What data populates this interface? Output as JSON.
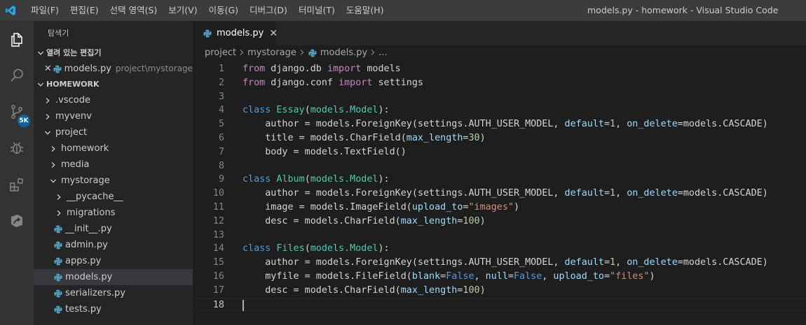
{
  "app": {
    "window_title": "models.py - homework - Visual Studio Code",
    "menu": [
      "파일(F)",
      "편집(E)",
      "선택 영역(S)",
      "보기(V)",
      "이동(G)",
      "디버그(D)",
      "터미널(T)",
      "도움말(H)"
    ]
  },
  "activity": {
    "scm_badge": "5K"
  },
  "sidebar": {
    "title": "탐색기",
    "open_editors_header": "열려 있는 편집기",
    "open_editor": {
      "name": "models.py",
      "path": "project\\mystorage"
    },
    "workspace_header": "HOMEWORK",
    "tree": [
      {
        "label": ".vscode",
        "kind": "folder",
        "open": false,
        "depth": 1
      },
      {
        "label": "myvenv",
        "kind": "folder",
        "open": false,
        "depth": 1
      },
      {
        "label": "project",
        "kind": "folder",
        "open": true,
        "depth": 1
      },
      {
        "label": "homework",
        "kind": "folder",
        "open": false,
        "depth": 2
      },
      {
        "label": "media",
        "kind": "folder",
        "open": false,
        "depth": 2
      },
      {
        "label": "mystorage",
        "kind": "folder",
        "open": true,
        "depth": 2
      },
      {
        "label": "__pycache__",
        "kind": "folder",
        "open": false,
        "depth": 3
      },
      {
        "label": "migrations",
        "kind": "folder",
        "open": false,
        "depth": 3
      },
      {
        "label": "__init__.py",
        "kind": "py",
        "depth": 3
      },
      {
        "label": "admin.py",
        "kind": "py",
        "depth": 3
      },
      {
        "label": "apps.py",
        "kind": "py",
        "depth": 3
      },
      {
        "label": "models.py",
        "kind": "py",
        "depth": 3,
        "selected": true
      },
      {
        "label": "serializers.py",
        "kind": "py",
        "depth": 3
      },
      {
        "label": "tests.py",
        "kind": "py",
        "depth": 3
      }
    ]
  },
  "editor": {
    "tab": {
      "label": "models.py"
    },
    "breadcrumb": [
      "project",
      "mystorage",
      "models.py",
      "..."
    ],
    "current_line": 18,
    "lines": [
      [
        [
          "kw",
          "from"
        ],
        [
          "t",
          " django.db "
        ],
        [
          "kw",
          "import"
        ],
        [
          "t",
          " models"
        ]
      ],
      [
        [
          "kw",
          "from"
        ],
        [
          "t",
          " django.conf "
        ],
        [
          "kw",
          "import"
        ],
        [
          "t",
          " settings"
        ]
      ],
      [],
      [
        [
          "kb",
          "class"
        ],
        [
          "t",
          " "
        ],
        [
          "cls",
          "Essay"
        ],
        [
          "t",
          "("
        ],
        [
          "cls",
          "models.Model"
        ],
        [
          "t",
          "):"
        ]
      ],
      [
        [
          "t",
          "    author = models.ForeignKey(settings.AUTH_USER_MODEL, "
        ],
        [
          "prm",
          "default"
        ],
        [
          "t",
          "="
        ],
        [
          "num",
          "1"
        ],
        [
          "t",
          ", "
        ],
        [
          "prm",
          "on_delete"
        ],
        [
          "t",
          "=models.CASCADE)"
        ]
      ],
      [
        [
          "t",
          "    title = models.CharField("
        ],
        [
          "prm",
          "max_length"
        ],
        [
          "t",
          "="
        ],
        [
          "num",
          "30"
        ],
        [
          "t",
          ")"
        ]
      ],
      [
        [
          "t",
          "    body = models.TextField()"
        ]
      ],
      [],
      [
        [
          "kb",
          "class"
        ],
        [
          "t",
          " "
        ],
        [
          "cls",
          "Album"
        ],
        [
          "t",
          "("
        ],
        [
          "cls",
          "models.Model"
        ],
        [
          "t",
          "):"
        ]
      ],
      [
        [
          "t",
          "    author = models.ForeignKey(settings.AUTH_USER_MODEL, "
        ],
        [
          "prm",
          "default"
        ],
        [
          "t",
          "="
        ],
        [
          "num",
          "1"
        ],
        [
          "t",
          ", "
        ],
        [
          "prm",
          "on_delete"
        ],
        [
          "t",
          "=models.CASCADE)"
        ]
      ],
      [
        [
          "t",
          "    image = models.ImageField("
        ],
        [
          "prm",
          "upload_to"
        ],
        [
          "t",
          "="
        ],
        [
          "str",
          "\"images\""
        ],
        [
          "t",
          ")"
        ]
      ],
      [
        [
          "t",
          "    desc = models.CharField("
        ],
        [
          "prm",
          "max_length"
        ],
        [
          "t",
          "="
        ],
        [
          "num",
          "100"
        ],
        [
          "t",
          ")"
        ]
      ],
      [],
      [
        [
          "kb",
          "class"
        ],
        [
          "t",
          " "
        ],
        [
          "cls",
          "Files"
        ],
        [
          "t",
          "("
        ],
        [
          "cls",
          "models.Model"
        ],
        [
          "t",
          "):"
        ]
      ],
      [
        [
          "t",
          "    author = models.ForeignKey(settings.AUTH_USER_MODEL, "
        ],
        [
          "prm",
          "default"
        ],
        [
          "t",
          "="
        ],
        [
          "num",
          "1"
        ],
        [
          "t",
          ", "
        ],
        [
          "prm",
          "on_delete"
        ],
        [
          "t",
          "=models.CASCADE)"
        ]
      ],
      [
        [
          "t",
          "    myfile = models.FileField("
        ],
        [
          "prm",
          "blank"
        ],
        [
          "t",
          "="
        ],
        [
          "kb",
          "False"
        ],
        [
          "t",
          ", "
        ],
        [
          "prm",
          "null"
        ],
        [
          "t",
          "="
        ],
        [
          "kb",
          "False"
        ],
        [
          "t",
          ", "
        ],
        [
          "prm",
          "upload_to"
        ],
        [
          "t",
          "="
        ],
        [
          "str",
          "\"files\""
        ],
        [
          "t",
          ")"
        ]
      ],
      [
        [
          "t",
          "    desc = models.CharField("
        ],
        [
          "prm",
          "max_length"
        ],
        [
          "t",
          "="
        ],
        [
          "num",
          "100"
        ],
        [
          "t",
          ")"
        ]
      ],
      []
    ]
  }
}
